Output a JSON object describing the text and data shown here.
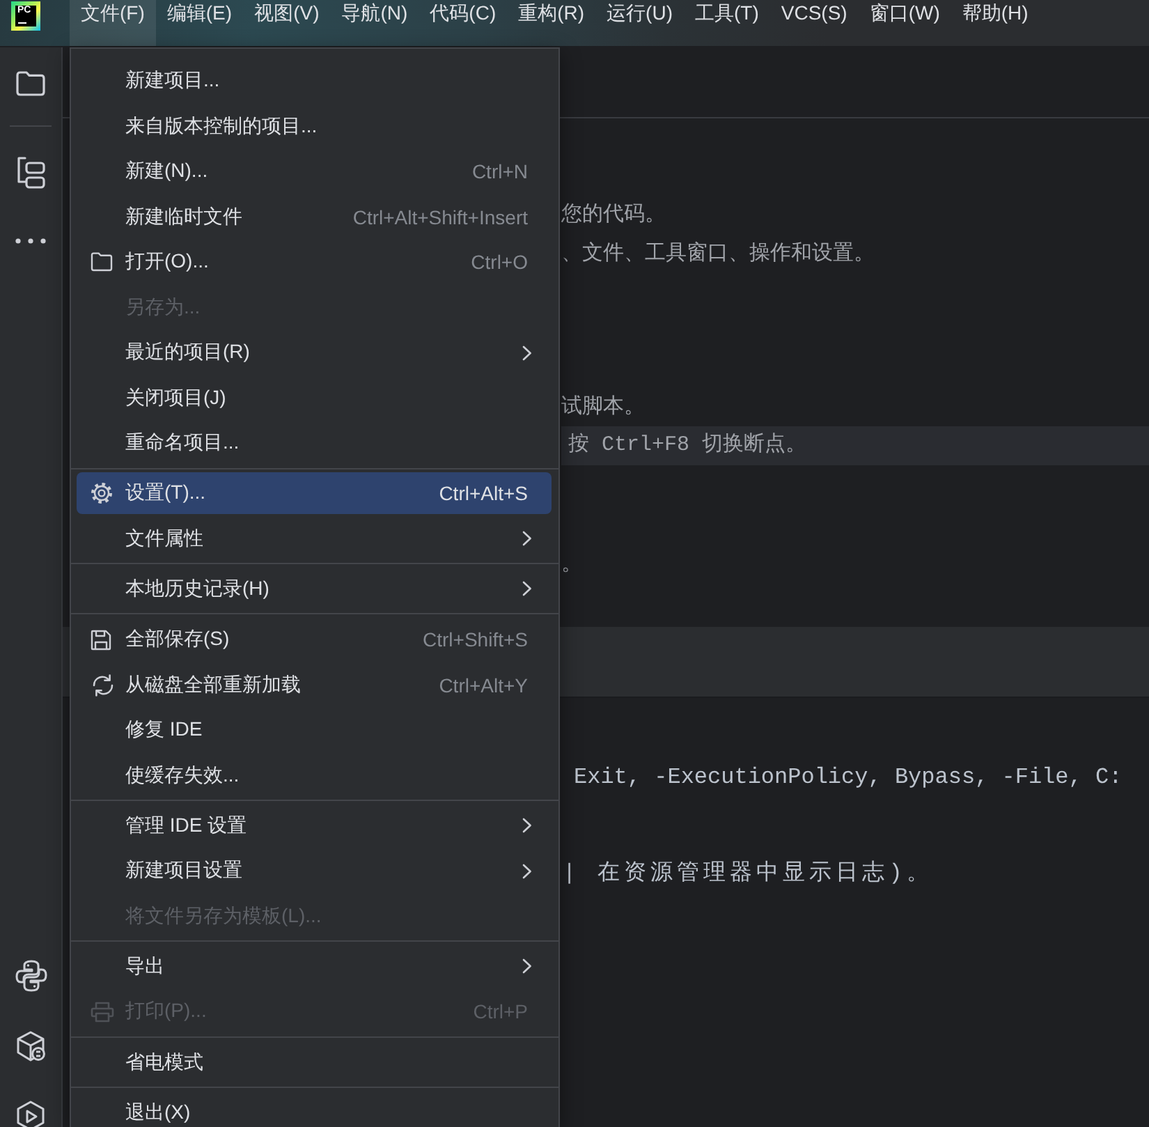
{
  "logo": {
    "text": "PC"
  },
  "menu_bar": [
    {
      "label": "文件(F)",
      "selected": true
    },
    {
      "label": "编辑(E)",
      "selected": false
    },
    {
      "label": "视图(V)",
      "selected": false
    },
    {
      "label": "导航(N)",
      "selected": false
    },
    {
      "label": "代码(C)",
      "selected": false
    },
    {
      "label": "重构(R)",
      "selected": false
    },
    {
      "label": "运行(U)",
      "selected": false
    },
    {
      "label": "工具(T)",
      "selected": false
    },
    {
      "label": "VCS(S)",
      "selected": false
    },
    {
      "label": "窗口(W)",
      "selected": false
    },
    {
      "label": "帮助(H)",
      "selected": false
    }
  ],
  "file_menu": {
    "groups": [
      {
        "items": [
          {
            "kind": "item",
            "label": "新建项目...",
            "selected": false,
            "disabled": false
          },
          {
            "kind": "item",
            "label": "来自版本控制的项目...",
            "selected": false,
            "disabled": false
          },
          {
            "kind": "item",
            "label": "新建(N)...",
            "shortcut": "Ctrl+N",
            "selected": false,
            "disabled": false
          },
          {
            "kind": "item",
            "label": "新建临时文件",
            "shortcut": "Ctrl+Alt+Shift+Insert",
            "selected": false,
            "disabled": false
          },
          {
            "kind": "item",
            "label": "打开(O)...",
            "shortcut": "Ctrl+O",
            "selected": false,
            "disabled": false
          },
          {
            "kind": "item",
            "label": "另存为...",
            "selected": false,
            "disabled": true
          },
          {
            "kind": "submenu",
            "label": "最近的项目(R)",
            "selected": false,
            "disabled": false
          },
          {
            "kind": "item",
            "label": "关闭项目(J)",
            "selected": false,
            "disabled": false
          },
          {
            "kind": "item",
            "label": "重命名项目...",
            "selected": false,
            "disabled": false
          }
        ]
      },
      {
        "items": [
          {
            "kind": "item",
            "label": "设置(T)...",
            "shortcut": "Ctrl+Alt+S",
            "selected": true,
            "disabled": false
          },
          {
            "kind": "submenu",
            "label": "文件属性",
            "selected": false,
            "disabled": false
          }
        ]
      },
      {
        "items": [
          {
            "kind": "submenu",
            "label": "本地历史记录(H)",
            "selected": false,
            "disabled": false
          }
        ]
      },
      {
        "items": [
          {
            "kind": "item",
            "label": "全部保存(S)",
            "shortcut": "Ctrl+Shift+S",
            "selected": false,
            "disabled": false
          },
          {
            "kind": "item",
            "label": "从磁盘全部重新加载",
            "shortcut": "Ctrl+Alt+Y",
            "selected": false,
            "disabled": false
          },
          {
            "kind": "item",
            "label": "修复 IDE",
            "selected": false,
            "disabled": false
          },
          {
            "kind": "item",
            "label": "使缓存失效...",
            "selected": false,
            "disabled": false
          }
        ]
      },
      {
        "items": [
          {
            "kind": "submenu",
            "label": "管理 IDE 设置",
            "selected": false,
            "disabled": false
          },
          {
            "kind": "submenu",
            "label": "新建项目设置",
            "selected": false,
            "disabled": false
          },
          {
            "kind": "item",
            "label": "将文件另存为模板(L)...",
            "selected": false,
            "disabled": true
          }
        ]
      },
      {
        "items": [
          {
            "kind": "submenu",
            "label": "导出",
            "selected": false,
            "disabled": false
          },
          {
            "kind": "item",
            "label": "打印(P)...",
            "shortcut": "Ctrl+P",
            "selected": false,
            "disabled": true
          }
        ]
      },
      {
        "items": [
          {
            "kind": "item",
            "label": "省电模式",
            "selected": false,
            "disabled": false
          }
        ]
      },
      {
        "items": [
          {
            "kind": "item",
            "label": "退出(X)",
            "selected": false,
            "disabled": false
          }
        ]
      }
    ]
  },
  "editor": {
    "lines": [
      {
        "text": "您的代码。",
        "highlighted": false
      },
      {
        "text": "、文件、工具窗口、操作和设置。",
        "highlighted": false
      },
      {
        "text": "试脚本。",
        "highlighted": false
      },
      {
        "text": "按 Ctrl+F8 切换断点。",
        "highlighted": true
      },
      {
        "text": "。",
        "highlighted": false
      }
    ]
  },
  "run_panel": {
    "lines": [
      {
        "text": "Exit, -ExecutionPolicy, Bypass, -File, C:"
      },
      {
        "text": "| 在资源管理器中显示日志)。"
      }
    ]
  }
}
